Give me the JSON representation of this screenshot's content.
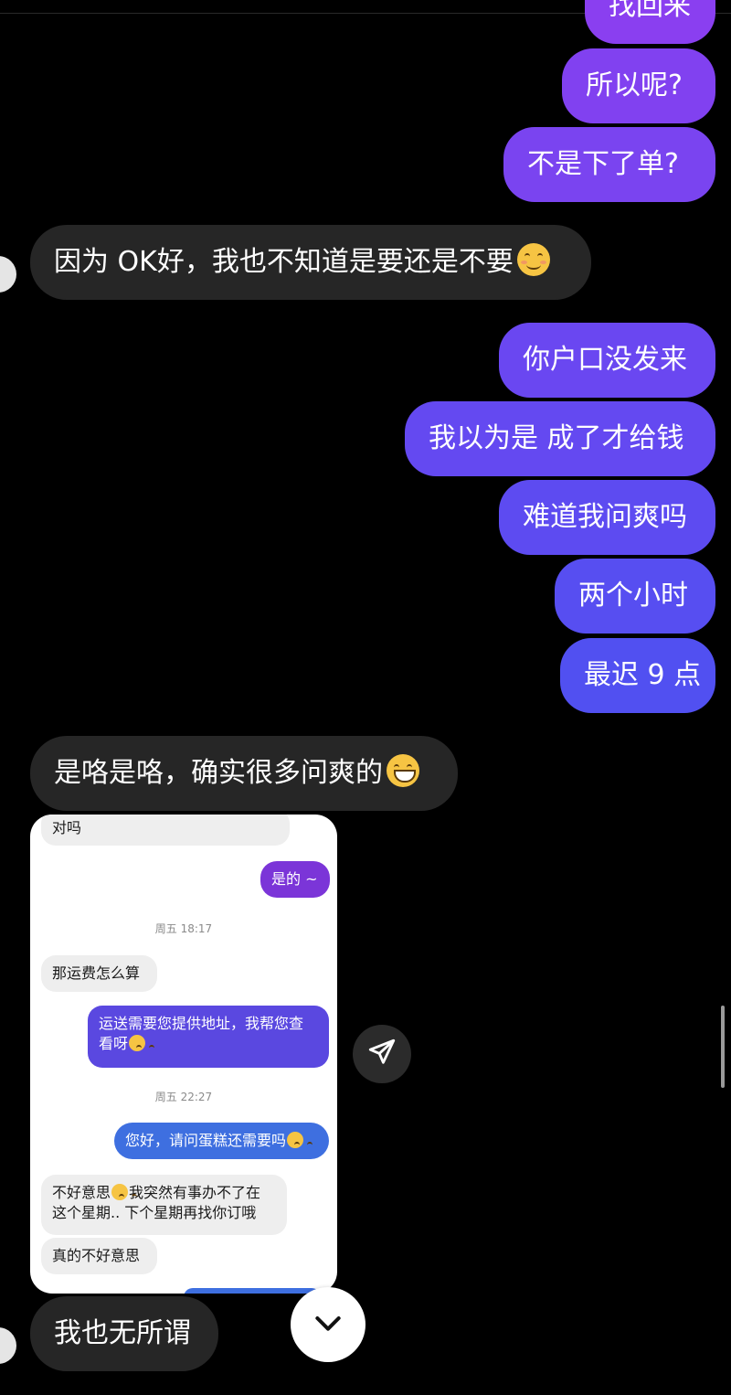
{
  "colors": {
    "outgoing_top": "#8a3ff0",
    "outgoing_bottom": "#4f52f0",
    "incoming": "#262626",
    "background": "#000000"
  },
  "messages": [
    {
      "id": "m0",
      "dir": "out",
      "text": "找回来",
      "partial": true
    },
    {
      "id": "m1",
      "dir": "out",
      "text": "所以呢?"
    },
    {
      "id": "m2",
      "dir": "out",
      "text": "不是下了单?"
    },
    {
      "id": "m3",
      "dir": "in",
      "text": "因为 OK好，我也不知道是要还是不要",
      "emoji": "smiling-blush-emoji"
    },
    {
      "id": "m4",
      "dir": "out",
      "text": "你户口没发来"
    },
    {
      "id": "m5",
      "dir": "out",
      "text": "我以为是 成了才给钱"
    },
    {
      "id": "m6",
      "dir": "out",
      "text": "难道我问爽吗"
    },
    {
      "id": "m7",
      "dir": "out",
      "text": "两个小时"
    },
    {
      "id": "m8",
      "dir": "out",
      "text": "最迟 9 点"
    },
    {
      "id": "m9",
      "dir": "in",
      "text": "是咯是咯，确实很多问爽的",
      "emoji": "grinning-emoji"
    },
    {
      "id": "m10",
      "dir": "in",
      "text": "我也无所谓"
    }
  ],
  "shared_screenshot": {
    "items": [
      {
        "type": "left",
        "text": "对吗"
      },
      {
        "type": "right",
        "text": "是的 ~"
      },
      {
        "type": "time",
        "text": "周五 18:17"
      },
      {
        "type": "left",
        "text": "那运费怎么算"
      },
      {
        "type": "right",
        "line1": "运送需要您提供地址，我帮您查",
        "line2": "看呀",
        "emoji": "smiling-blush-emoji"
      },
      {
        "type": "time",
        "text": "周五 22:27"
      },
      {
        "type": "right",
        "text": "您好，请问蛋糕还需要吗",
        "emoji": "smiling-blush-emoji"
      },
      {
        "type": "left",
        "line1_a": "不好意思",
        "line1_b": "我突然有事办不了在",
        "line2": "这个星期.. 下个星期再找你订哦",
        "emoji": "grimace-emoji"
      },
      {
        "type": "left",
        "text": "真的不好意思"
      }
    ]
  },
  "controls": {
    "share_icon": "paper-plane-icon",
    "scroll_down_icon": "chevron-down-icon"
  }
}
